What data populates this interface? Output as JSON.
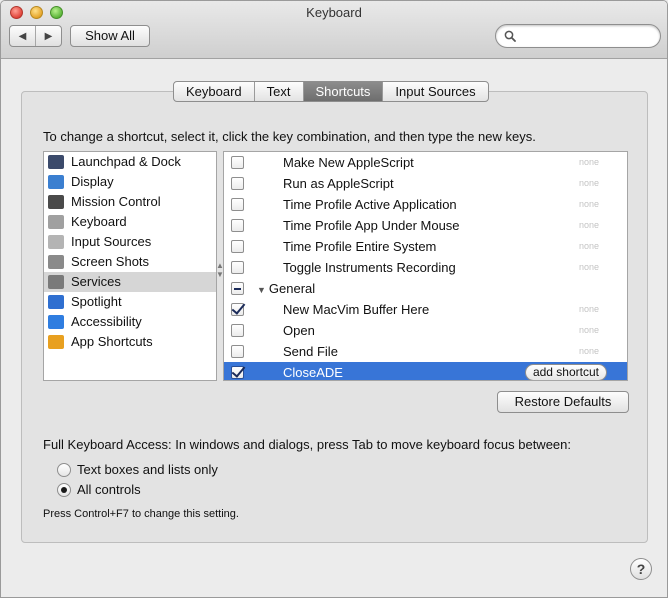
{
  "window": {
    "title": "Keyboard"
  },
  "toolbar": {
    "back_icon": "chevron-left-icon",
    "forward_icon": "chevron-right-icon",
    "back_glyph": "◀",
    "forward_glyph": "▶",
    "show_all_label": "Show All",
    "search": {
      "value": "",
      "placeholder": ""
    }
  },
  "tabs": [
    {
      "label": "Keyboard",
      "active": false
    },
    {
      "label": "Text",
      "active": false
    },
    {
      "label": "Shortcuts",
      "active": true
    },
    {
      "label": "Input Sources",
      "active": false
    }
  ],
  "instructions": "To change a shortcut, select it, click the key combination, and then type the new keys.",
  "categories": [
    {
      "label": "Launchpad & Dock",
      "icon": "launchpad-icon",
      "color": "#3b4a6b",
      "selected": false
    },
    {
      "label": "Display",
      "icon": "display-icon",
      "color": "#3b7fd0",
      "selected": false
    },
    {
      "label": "Mission Control",
      "icon": "mission-control-icon",
      "color": "#4a4a4a",
      "selected": false
    },
    {
      "label": "Keyboard",
      "icon": "keyboard-icon",
      "color": "#a0a0a0",
      "selected": false
    },
    {
      "label": "Input Sources",
      "icon": "input-sources-icon",
      "color": "#b4b4b4",
      "selected": false
    },
    {
      "label": "Screen Shots",
      "icon": "screenshots-icon",
      "color": "#8a8a8a",
      "selected": false
    },
    {
      "label": "Services",
      "icon": "gear-icon",
      "color": "#7a7a7a",
      "selected": true
    },
    {
      "label": "Spotlight",
      "icon": "spotlight-icon",
      "color": "#2f6fd0",
      "selected": false
    },
    {
      "label": "Accessibility",
      "icon": "accessibility-icon",
      "color": "#2f7de0",
      "selected": false
    },
    {
      "label": "App Shortcuts",
      "icon": "app-shortcuts-icon",
      "color": "#e8a020",
      "selected": false
    }
  ],
  "shortcuts": [
    {
      "label": "Make New AppleScript",
      "checked": false,
      "shortcut": "none",
      "type": "item",
      "selected": false
    },
    {
      "label": "Run as AppleScript",
      "checked": false,
      "shortcut": "none",
      "type": "item",
      "selected": false
    },
    {
      "label": "Time Profile Active Application",
      "checked": false,
      "shortcut": "none",
      "type": "item",
      "selected": false
    },
    {
      "label": "Time Profile App Under Mouse",
      "checked": false,
      "shortcut": "none",
      "type": "item",
      "selected": false
    },
    {
      "label": "Time Profile Entire System",
      "checked": false,
      "shortcut": "none",
      "type": "item",
      "selected": false
    },
    {
      "label": "Toggle Instruments Recording",
      "checked": false,
      "shortcut": "none",
      "type": "item",
      "selected": false
    },
    {
      "label": "General",
      "checked": "mixed",
      "shortcut": "",
      "type": "group",
      "selected": false
    },
    {
      "label": "New MacVim Buffer Here",
      "checked": true,
      "shortcut": "none",
      "type": "item",
      "selected": false
    },
    {
      "label": "Open",
      "checked": false,
      "shortcut": "none",
      "type": "item",
      "selected": false
    },
    {
      "label": "Send File",
      "checked": false,
      "shortcut": "none",
      "type": "item",
      "selected": false
    },
    {
      "label": "CloseADE",
      "checked": true,
      "shortcut": "add shortcut",
      "type": "item",
      "selected": true
    }
  ],
  "restore_defaults_label": "Restore Defaults",
  "full_keyboard_access": {
    "label": "Full Keyboard Access: In windows and dialogs, press Tab to move keyboard focus between:",
    "options": [
      {
        "label": "Text boxes and lists only",
        "selected": false
      },
      {
        "label": "All controls",
        "selected": true
      }
    ],
    "hint": "Press Control+F7 to change this setting."
  },
  "help_label": "?",
  "accent_color": "#3875d7"
}
